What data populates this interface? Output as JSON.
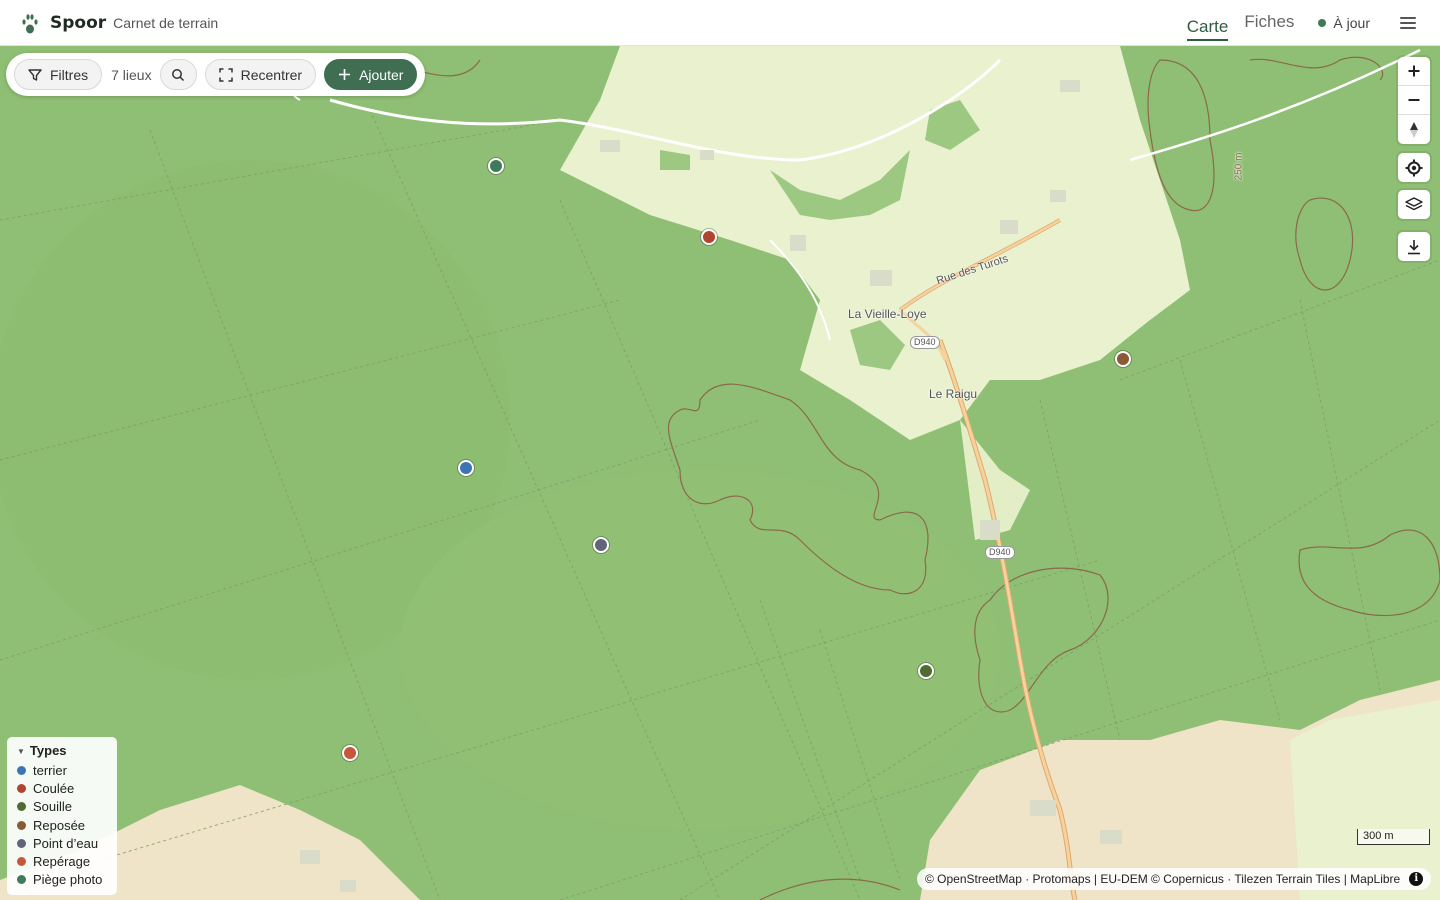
{
  "header": {
    "app_name": "Spoor",
    "subtitle": "Carnet de terrain",
    "tabs": [
      {
        "label": "Carte",
        "active": true
      },
      {
        "label": "Fiches",
        "active": false
      }
    ],
    "status_label": "À jour",
    "status_color": "#3d7a55"
  },
  "toolbar": {
    "filters_label": "Filtres",
    "count_label": "7 lieux",
    "recenter_label": "Recentrer",
    "add_label": "Ajouter",
    "accent": "#3f6e53"
  },
  "map_controls": {
    "zoom_in": "zoom-in-icon",
    "zoom_out": "zoom-out-icon",
    "compass": "compass-icon",
    "locate": "locate-icon",
    "layers": "layers-icon",
    "download": "download-icon"
  },
  "map_labels": {
    "place_1": "La Vieille-Loye",
    "place_2": "Le Raigu",
    "street_1": "Rue des Turots",
    "road_1": "D940",
    "road_2": "D940",
    "contour_1": "250 m"
  },
  "legend": {
    "title": "Types",
    "items": [
      {
        "label": "terrier",
        "color": "#3c74b4"
      },
      {
        "label": "Coulée",
        "color": "#b0442c"
      },
      {
        "label": "Souille",
        "color": "#506a34"
      },
      {
        "label": "Reposée",
        "color": "#8a5a34"
      },
      {
        "label": "Point d’eau",
        "color": "#62657a"
      },
      {
        "label": "Repérage",
        "color": "#c4583a"
      },
      {
        "label": "Piège photo",
        "color": "#3f7a5a"
      }
    ]
  },
  "markers": [
    {
      "type": "Piège photo",
      "color": "#3f7a5a"
    },
    {
      "type": "Coulée",
      "color": "#b0442c"
    },
    {
      "type": "Reposée",
      "color": "#8a5a34"
    },
    {
      "type": "terrier",
      "color": "#3c74b4"
    },
    {
      "type": "Point d’eau",
      "color": "#62657a"
    },
    {
      "type": "Souille",
      "color": "#506a34"
    },
    {
      "type": "Repérage",
      "color": "#c4583a"
    }
  ],
  "scale_label": "300 m",
  "attribution": "© OpenStreetMap · Protomaps | EU-DEM © Copernicus · Tilezen Terrain Tiles | MapLibre",
  "colors": {
    "forest": "#8fbf74",
    "open_land": "#e9f1cf",
    "fields": "#efe4c8",
    "contour": "#8a6a4a",
    "road": "#f2c78a"
  }
}
